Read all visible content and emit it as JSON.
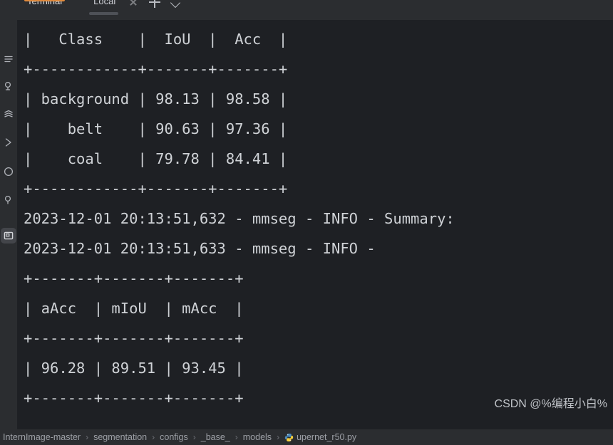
{
  "window": {
    "tool_window_tab": "Terminal",
    "accent_color": "#e08a3c"
  },
  "terminal_tabs": {
    "active_tab": "Local",
    "close_icon": "close-icon",
    "add_icon": "plus-icon",
    "more_icon": "chevron-down-icon"
  },
  "sidebar": {
    "items": [
      {
        "icon": "menu-lines-icon",
        "active": false
      },
      {
        "icon": "commit-icon",
        "active": false
      },
      {
        "icon": "stack-layers-icon",
        "active": false
      },
      {
        "icon": "chevron-right-run-icon",
        "active": false
      },
      {
        "icon": "circle-clock-icon",
        "active": false
      },
      {
        "icon": "question-balloon-icon",
        "active": false
      },
      {
        "icon": "terminal-window-icon",
        "active": true
      }
    ]
  },
  "terminal": {
    "lines": [
      "|   Class    |  IoU  |  Acc  |",
      "+------------+-------+-------+",
      "| background | 98.13 | 98.58 |",
      "|    belt    | 90.63 | 97.36 |",
      "|    coal    | 79.78 | 84.41 |",
      "+------------+-------+-------+",
      "2023-12-01 20:13:51,632 - mmseg - INFO - Summary:",
      "2023-12-01 20:13:51,633 - mmseg - INFO -",
      "+-------+-------+-------+",
      "| aAcc  | mIoU  | mAcc  |",
      "+-------+-------+-------+",
      "| 96.28 | 89.51 | 93.45 |",
      "+-------+-------+-------+"
    ],
    "class_table": {
      "headers": [
        "Class",
        "IoU",
        "Acc"
      ],
      "rows": [
        [
          "background",
          "98.13",
          "98.58"
        ],
        [
          "belt",
          "90.63",
          "97.36"
        ],
        [
          "coal",
          "79.78",
          "84.41"
        ]
      ]
    },
    "summary_table": {
      "headers": [
        "aAcc",
        "mIoU",
        "mAcc"
      ],
      "rows": [
        [
          "96.28",
          "89.51",
          "93.45"
        ]
      ]
    },
    "log_lines": [
      "2023-12-01 20:13:51,632 - mmseg - INFO - Summary:",
      "2023-12-01 20:13:51,633 - mmseg - INFO -"
    ]
  },
  "watermark": {
    "text": "CSDN @%编程小白%"
  },
  "breadcrumb": {
    "separator": "›",
    "items": [
      {
        "label": "InternImage-master",
        "icon": null
      },
      {
        "label": "segmentation",
        "icon": null
      },
      {
        "label": "configs",
        "icon": null
      },
      {
        "label": "_base_",
        "icon": null
      },
      {
        "label": "models",
        "icon": null
      },
      {
        "label": "upernet_r50.py",
        "icon": "python-file-icon"
      }
    ]
  }
}
